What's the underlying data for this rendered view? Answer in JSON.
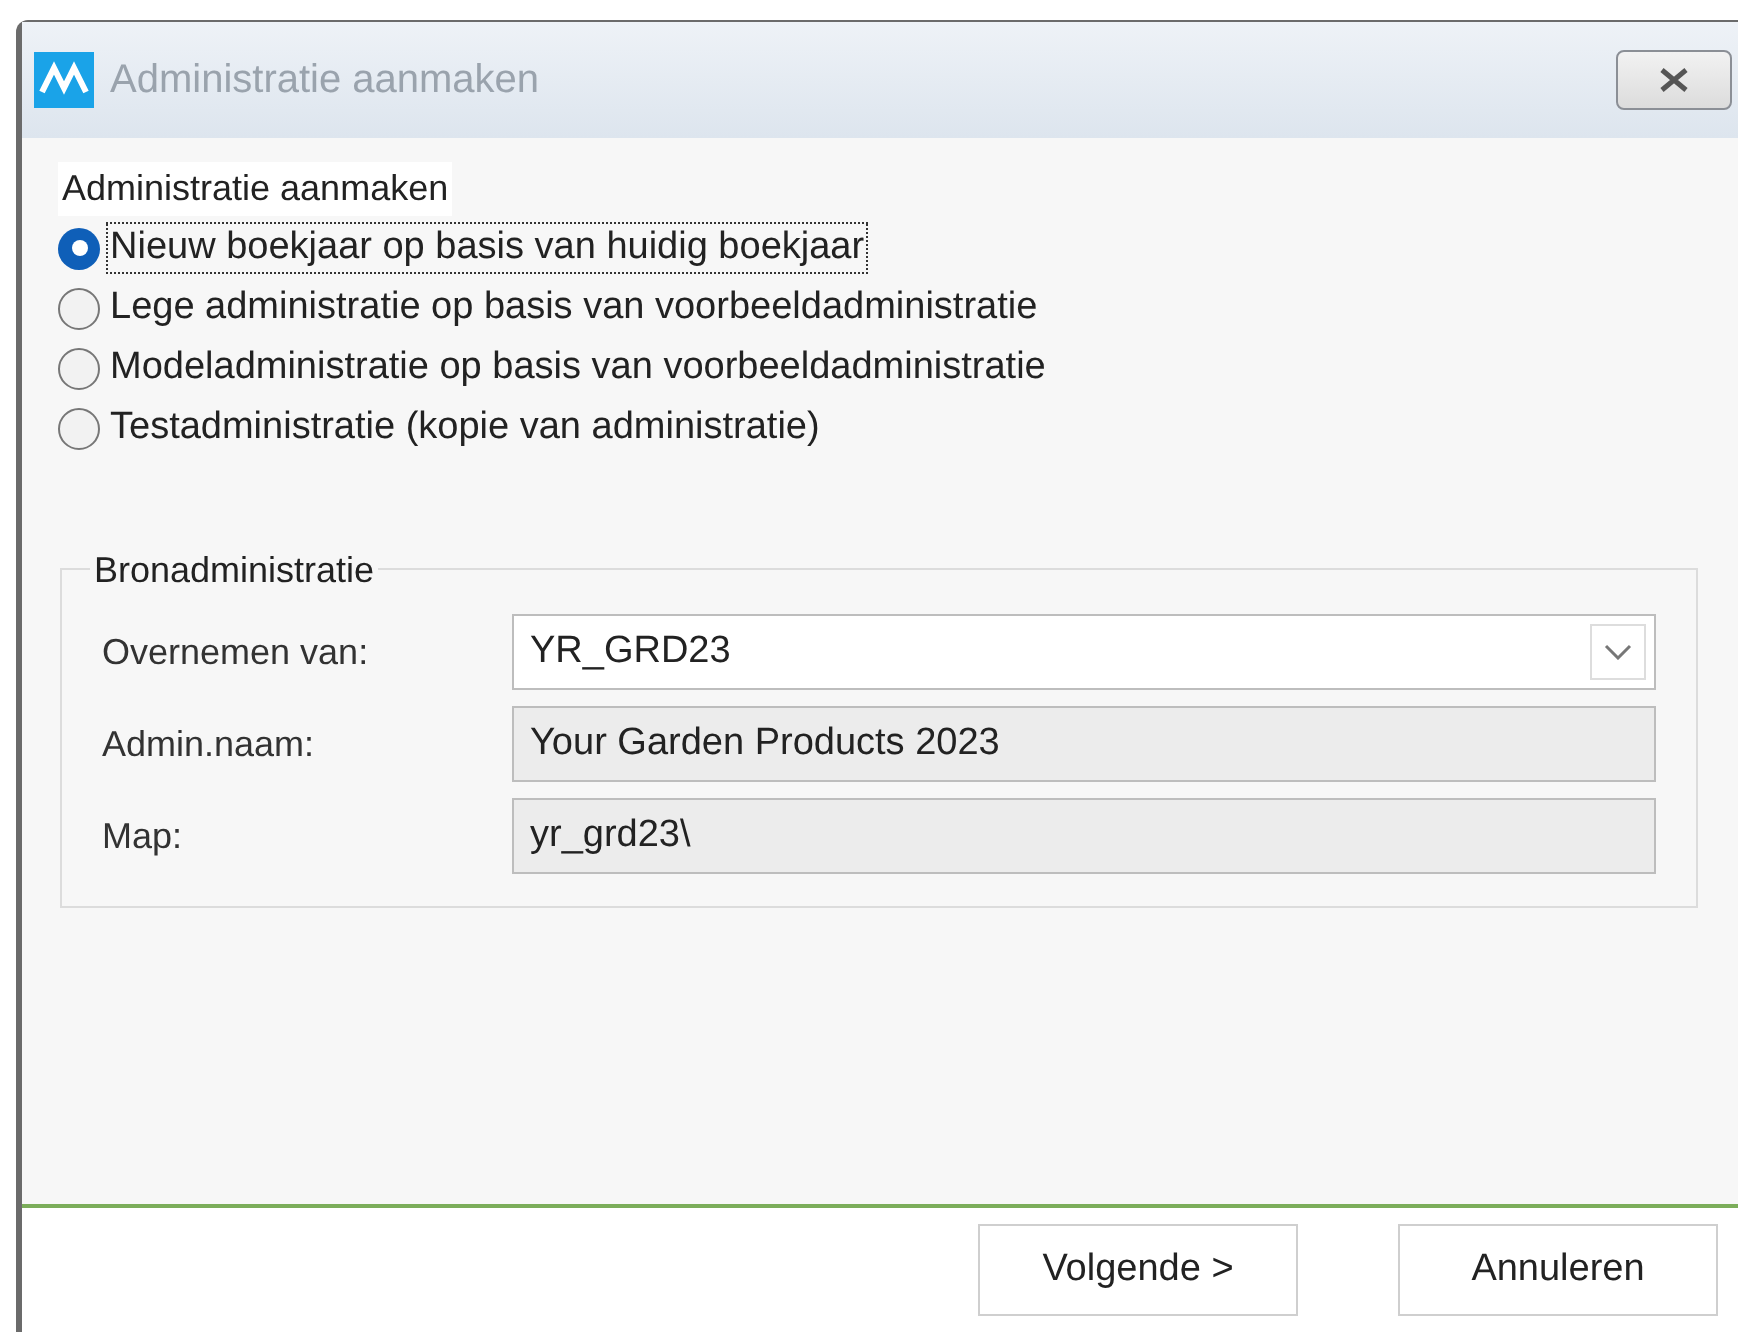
{
  "window": {
    "title": "Administratie aanmaken"
  },
  "options_group": {
    "label": "Administratie aanmaken",
    "options": [
      {
        "label": "Nieuw boekjaar op basis van huidig boekjaar",
        "selected": true,
        "focused": true
      },
      {
        "label": "Lege administratie op basis van voorbeeldadministratie",
        "selected": false,
        "focused": false
      },
      {
        "label": "Modeladministratie op basis van voorbeeldadministratie",
        "selected": false,
        "focused": false
      },
      {
        "label": "Testadministratie (kopie van administratie)",
        "selected": false,
        "focused": false
      }
    ]
  },
  "source_group": {
    "title": "Bronadministratie",
    "fields": [
      {
        "label": "Overnemen van:",
        "value": "YR_GRD23",
        "kind": "dropdown"
      },
      {
        "label": "Admin.naam:",
        "value": "Your Garden Products 2023",
        "kind": "readonly"
      },
      {
        "label": "Map:",
        "value": "yr_grd23\\",
        "kind": "readonly"
      }
    ]
  },
  "buttons": [
    "Volgende >",
    "Annuleren"
  ]
}
